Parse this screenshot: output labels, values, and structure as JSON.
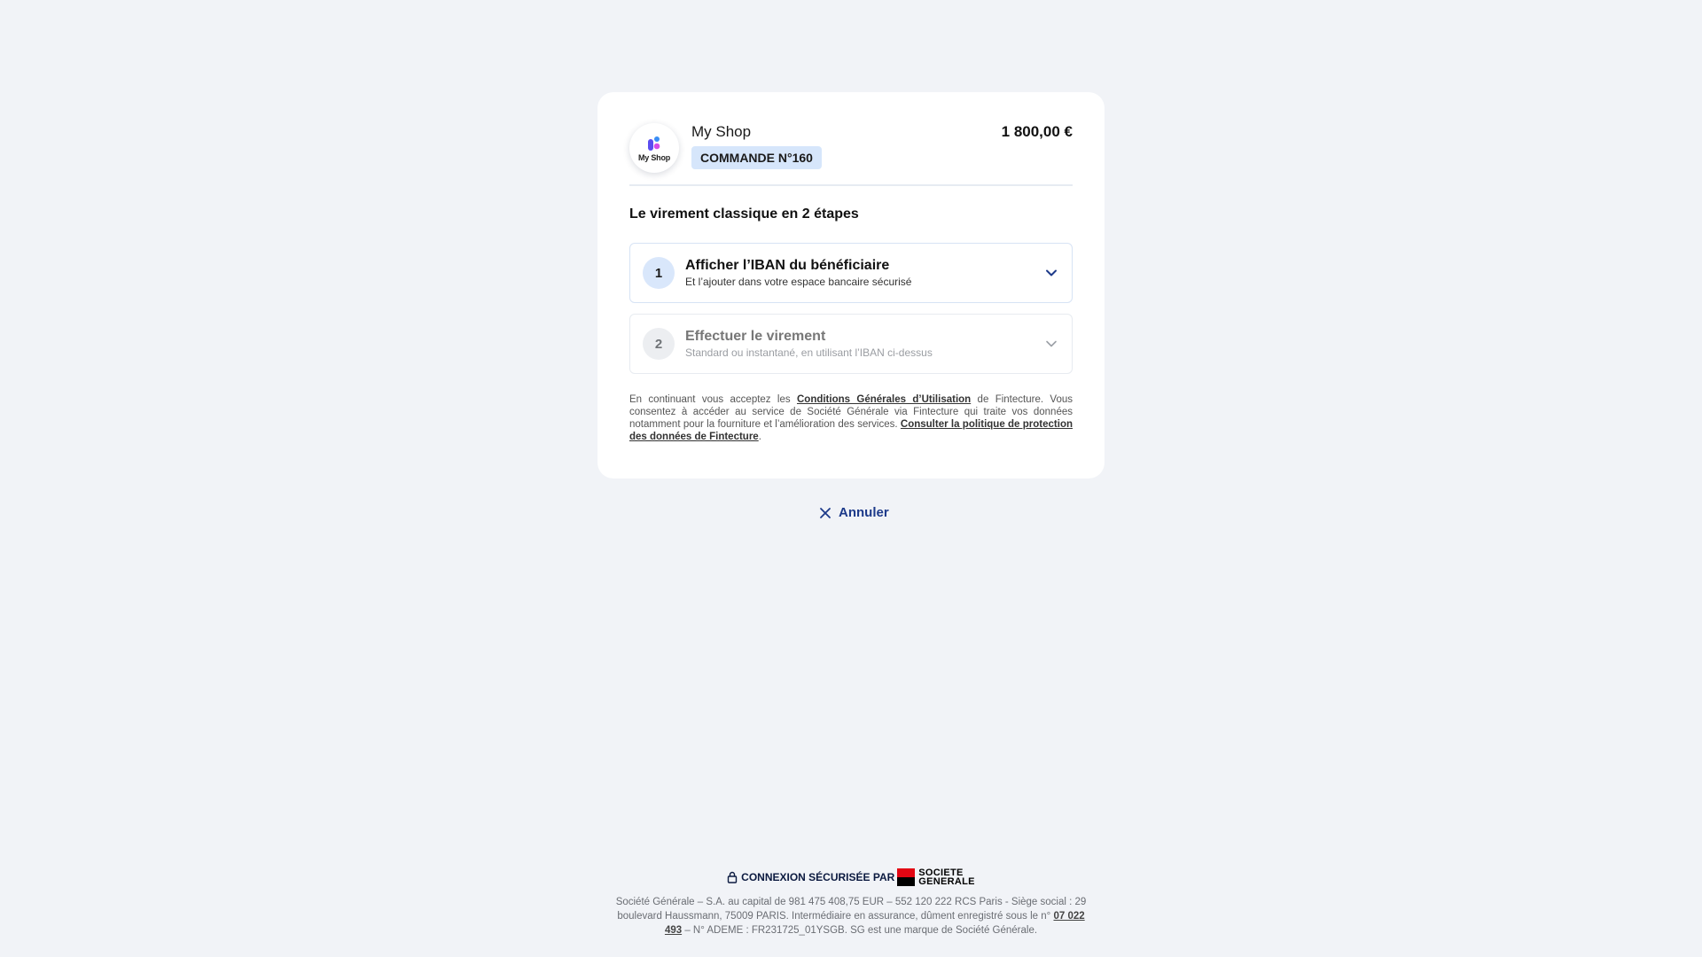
{
  "merchant": {
    "logo_text": "My Shop",
    "name": "My Shop",
    "order_label": "COMMANDE N°160",
    "amount": "1 800,00 €"
  },
  "section_title": "Le virement classique en 2 étapes",
  "steps": [
    {
      "number": "1",
      "title": "Afficher l’IBAN du bénéficiaire",
      "subtitle": "Et l’ajouter dans votre espace bancaire sécurisé",
      "icon": "chevron-down-icon"
    },
    {
      "number": "2",
      "title": "Effectuer le virement",
      "subtitle": "Standard ou instantané, en utilisant l’IBAN ci-dessus",
      "icon": "chevron-down-icon"
    }
  ],
  "legal": {
    "part1": "En continuant vous acceptez les ",
    "cgu_link": "Conditions Générales d’Utilisation",
    "part2": " de Fintecture. Vous consentez à accéder au service de Société Générale via Fintecture qui traite vos données notamment pour la fourniture et l’amélioration des services. ",
    "privacy_link": "Consulter la politique de protection des données de Fintecture",
    "part3": "."
  },
  "cancel_label": "Annuler",
  "footer": {
    "secure_label": "CONNEXION SÉCURISÉE PAR",
    "bank_logo_line1": "SOCIETE",
    "bank_logo_line2": "GENERALE",
    "legal_part1": "Société Générale – S.A. au capital de 981 475 408,75 EUR – 552 120 222 RCS Paris - Siège social : 29 boulevard Haussmann, 75009 PARIS. Intermédiaire en assurance, dûment enregistré sous le n° ",
    "orias_link": "07 022 493",
    "legal_part2": " – N° ADEME : FR231725_01YSGB. SG est une marque de Société Générale."
  },
  "colors": {
    "background": "#f1f3f7",
    "accent": "#1d3a8a",
    "badge": "#d6e6fb",
    "sg_red": "#e30613"
  }
}
